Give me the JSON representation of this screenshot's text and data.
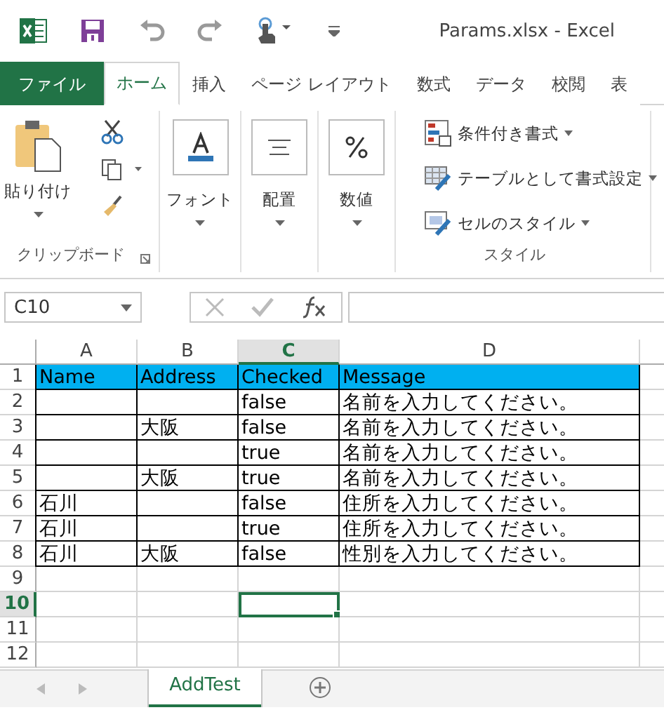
{
  "window": {
    "title": "Params.xlsx - Excel"
  },
  "tabs": [
    {
      "label": "ファイル",
      "kind": "file",
      "selected": false
    },
    {
      "label": "ホーム",
      "kind": "tab",
      "selected": true
    },
    {
      "label": "挿入",
      "kind": "tab",
      "selected": false
    },
    {
      "label": "ページ レイアウト",
      "kind": "tab",
      "selected": false
    },
    {
      "label": "数式",
      "kind": "tab",
      "selected": false
    },
    {
      "label": "データ",
      "kind": "tab",
      "selected": false
    },
    {
      "label": "校閲",
      "kind": "tab",
      "selected": false
    },
    {
      "label": "表",
      "kind": "tab",
      "selected": false
    }
  ],
  "ribbon": {
    "clipboard": {
      "paste": "貼り付け",
      "label": "クリップボード"
    },
    "buttons": [
      {
        "label": "フォント",
        "kind": "font"
      },
      {
        "label": "配置",
        "kind": "align"
      },
      {
        "label": "数値",
        "kind": "number"
      }
    ],
    "styles": {
      "items": [
        {
          "label": "条件付き書式",
          "kind": "conditional"
        },
        {
          "label": "テーブルとして書式設定",
          "kind": "table"
        },
        {
          "label": "セルのスタイル",
          "kind": "cell"
        }
      ],
      "label": "スタイル"
    }
  },
  "formula_bar": {
    "name_box": "C10"
  },
  "columns": [
    {
      "label": "A",
      "selected": false
    },
    {
      "label": "B",
      "selected": false
    },
    {
      "label": "C",
      "selected": true
    },
    {
      "label": "D",
      "selected": false
    }
  ],
  "rows": [
    {
      "label": "1",
      "kind": "header",
      "selected": false,
      "cells": {
        "A": "Name",
        "B": "Address",
        "C": "Checked",
        "D": "Message"
      }
    },
    {
      "label": "2",
      "kind": "data",
      "selected": false,
      "cells": {
        "C": "false",
        "D": "名前を入力してください。"
      }
    },
    {
      "label": "3",
      "kind": "data",
      "selected": false,
      "cells": {
        "B": "大阪",
        "C": "false",
        "D": "名前を入力してください。"
      }
    },
    {
      "label": "4",
      "kind": "data",
      "selected": false,
      "cells": {
        "C": "true",
        "D": "名前を入力してください。"
      }
    },
    {
      "label": "5",
      "kind": "data",
      "selected": false,
      "cells": {
        "B": "大阪",
        "C": "true",
        "D": "名前を入力してください。"
      }
    },
    {
      "label": "6",
      "kind": "data",
      "selected": false,
      "cells": {
        "A": "石川",
        "C": "false",
        "D": "住所を入力してください。"
      }
    },
    {
      "label": "7",
      "kind": "data",
      "selected": false,
      "cells": {
        "A": "石川",
        "C": "true",
        "D": "住所を入力してください。"
      }
    },
    {
      "label": "8",
      "kind": "data",
      "selected": false,
      "cells": {
        "A": "石川",
        "B": "大阪",
        "C": "false",
        "D": "性別を入力してください。"
      }
    },
    {
      "label": "9",
      "kind": "blank",
      "selected": false
    },
    {
      "label": "10",
      "kind": "blank",
      "selected": true
    },
    {
      "label": "11",
      "kind": "blank",
      "selected": false
    },
    {
      "label": "12",
      "kind": "blank",
      "selected": false
    }
  ],
  "sheets": [
    {
      "label": "AddTest",
      "selected": true
    }
  ]
}
